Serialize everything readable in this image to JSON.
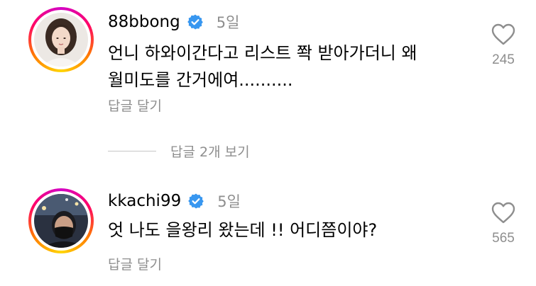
{
  "comments": [
    {
      "username": "88bbong",
      "time": "5일",
      "text": "언니 하와이간다고 리스트 쫙 받아가더니 왜\n월미도를 간거에여..........",
      "reply_label": "답글 달기",
      "like_count": "245",
      "avatar_icon": "profile-photo-woman"
    },
    {
      "username": "kkachi99",
      "time": "5일",
      "text": "엇 나도 을왕리 왔는데 !! 어디쯤이야?",
      "reply_label": "답글 달기",
      "like_count": "565",
      "avatar_icon": "profile-photo-man-mask"
    }
  ],
  "view_replies_label": "답글 2개 보기",
  "colors": {
    "verified_badge": "#3897f0",
    "secondary_text": "#8e8e8e",
    "divider": "#c7c7c7",
    "story_ring": [
      "#d300c5",
      "#ff0069",
      "#ff7a00",
      "#ffd600"
    ]
  },
  "icons": {
    "like": "heart-outline-icon",
    "verified": "verified-badge-icon"
  }
}
